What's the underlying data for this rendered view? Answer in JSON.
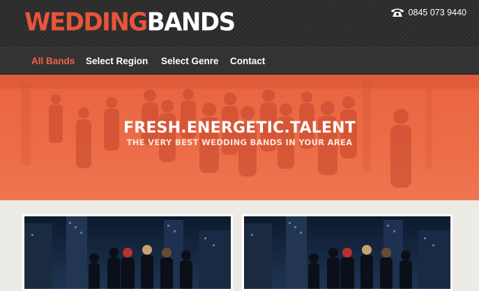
{
  "brand": {
    "part1": "WEDDING",
    "part2": "BANDS"
  },
  "contact": {
    "phone": "0845 073 9440",
    "icon": "telephone-icon"
  },
  "nav": {
    "items": [
      {
        "label": "All Bands",
        "active": true
      },
      {
        "label": "Select Region",
        "active": false
      },
      {
        "label": "Select Genre",
        "active": false
      },
      {
        "label": "Contact",
        "active": false
      }
    ]
  },
  "hero": {
    "title": "FRESH.ENERGETIC.TALENT",
    "subtitle": "THE VERY BEST WEDDING BANDS IN YOUR AREA"
  },
  "colors": {
    "accent": "#ee6244",
    "header": "#2b2b2b",
    "nav": "#333333",
    "hero": "#ec6c46",
    "page": "#ecebe5"
  },
  "cards": [
    {
      "image": "band-photo"
    },
    {
      "image": "band-photo"
    }
  ]
}
